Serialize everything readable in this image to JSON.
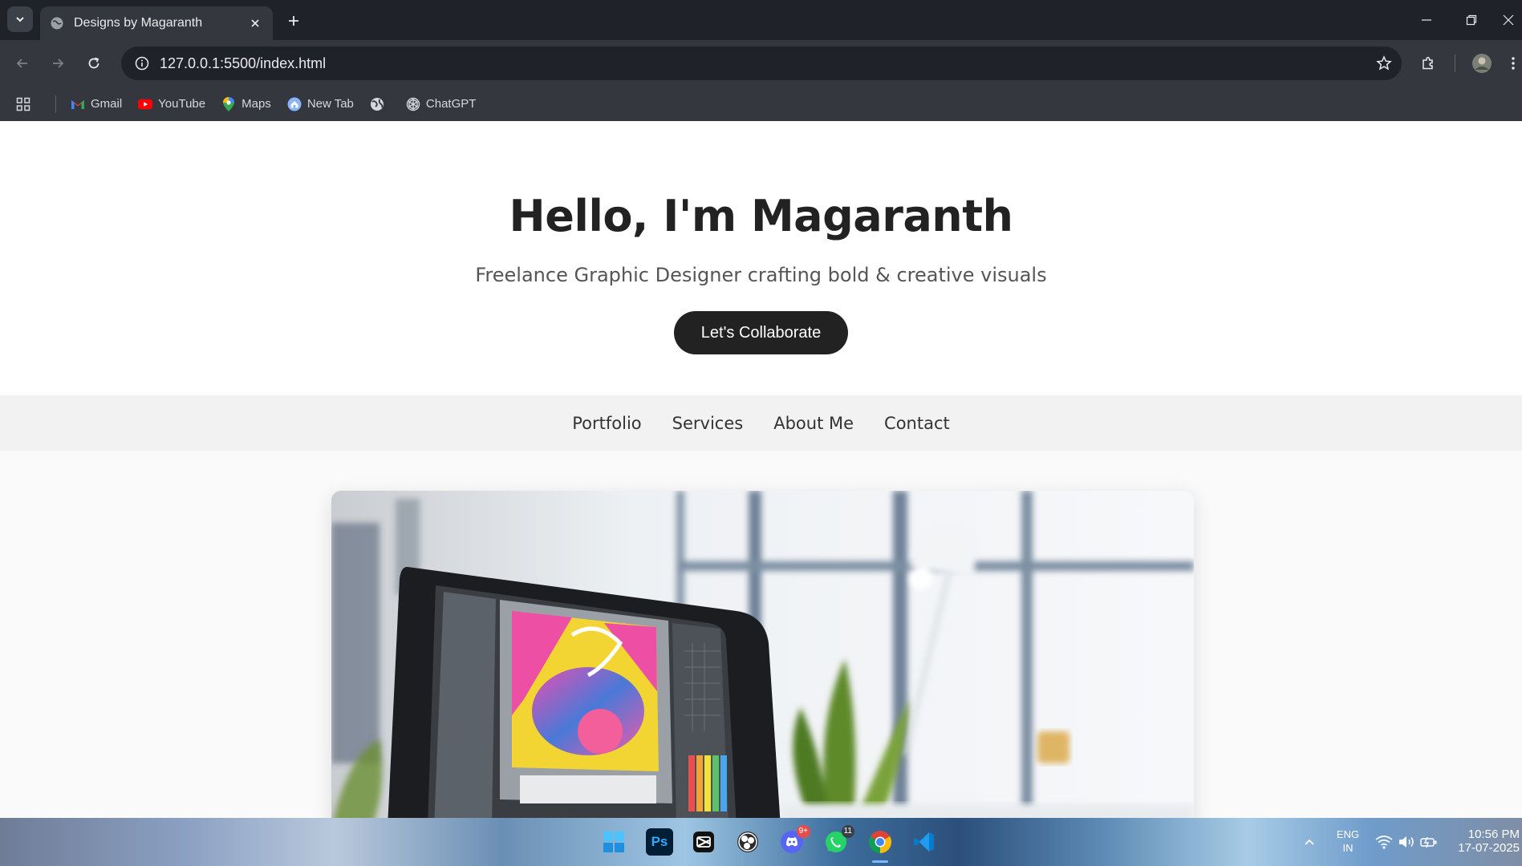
{
  "browser": {
    "tab": {
      "title": "Designs by Magaranth"
    },
    "address_bar": {
      "url": "127.0.0.1:5500/index.html"
    },
    "bookmarks": [
      {
        "label": "Gmail",
        "icon": "gmail-icon"
      },
      {
        "label": "YouTube",
        "icon": "youtube-icon"
      },
      {
        "label": "Maps",
        "icon": "maps-icon"
      },
      {
        "label": "New Tab",
        "icon": "new-tab-icon"
      },
      {
        "label": "",
        "icon": "globe-icon"
      },
      {
        "label": "ChatGPT",
        "icon": "chatgpt-icon"
      }
    ]
  },
  "page": {
    "hero": {
      "heading": "Hello, I'm Magaranth",
      "subheading": "Freelance Graphic Designer crafting bold & creative visuals",
      "cta_label": "Let's Collaborate"
    },
    "nav": [
      "Portfolio",
      "Services",
      "About Me",
      "Contact"
    ]
  },
  "taskbar": {
    "apps": [
      {
        "name": "start-button",
        "icon": "windows-icon"
      },
      {
        "name": "photoshop",
        "icon": "photoshop-icon",
        "label": "Ps"
      },
      {
        "name": "capcut",
        "icon": "capcut-icon"
      },
      {
        "name": "obs",
        "icon": "obs-icon"
      },
      {
        "name": "discord",
        "icon": "discord-icon",
        "badge": "9+"
      },
      {
        "name": "whatsapp",
        "icon": "whatsapp-icon",
        "badge": "11"
      },
      {
        "name": "chrome",
        "icon": "chrome-icon"
      },
      {
        "name": "vscode",
        "icon": "vscode-icon"
      }
    ],
    "tray": {
      "language": "ENG",
      "region": "IN",
      "time": "10:56 PM",
      "date": "17-07-2025"
    }
  },
  "colors": {
    "chrome_dark": "#1f2229",
    "chrome_toolbar": "#34373e",
    "cta_bg": "#222222",
    "nav_bg": "#f2f2f2"
  }
}
